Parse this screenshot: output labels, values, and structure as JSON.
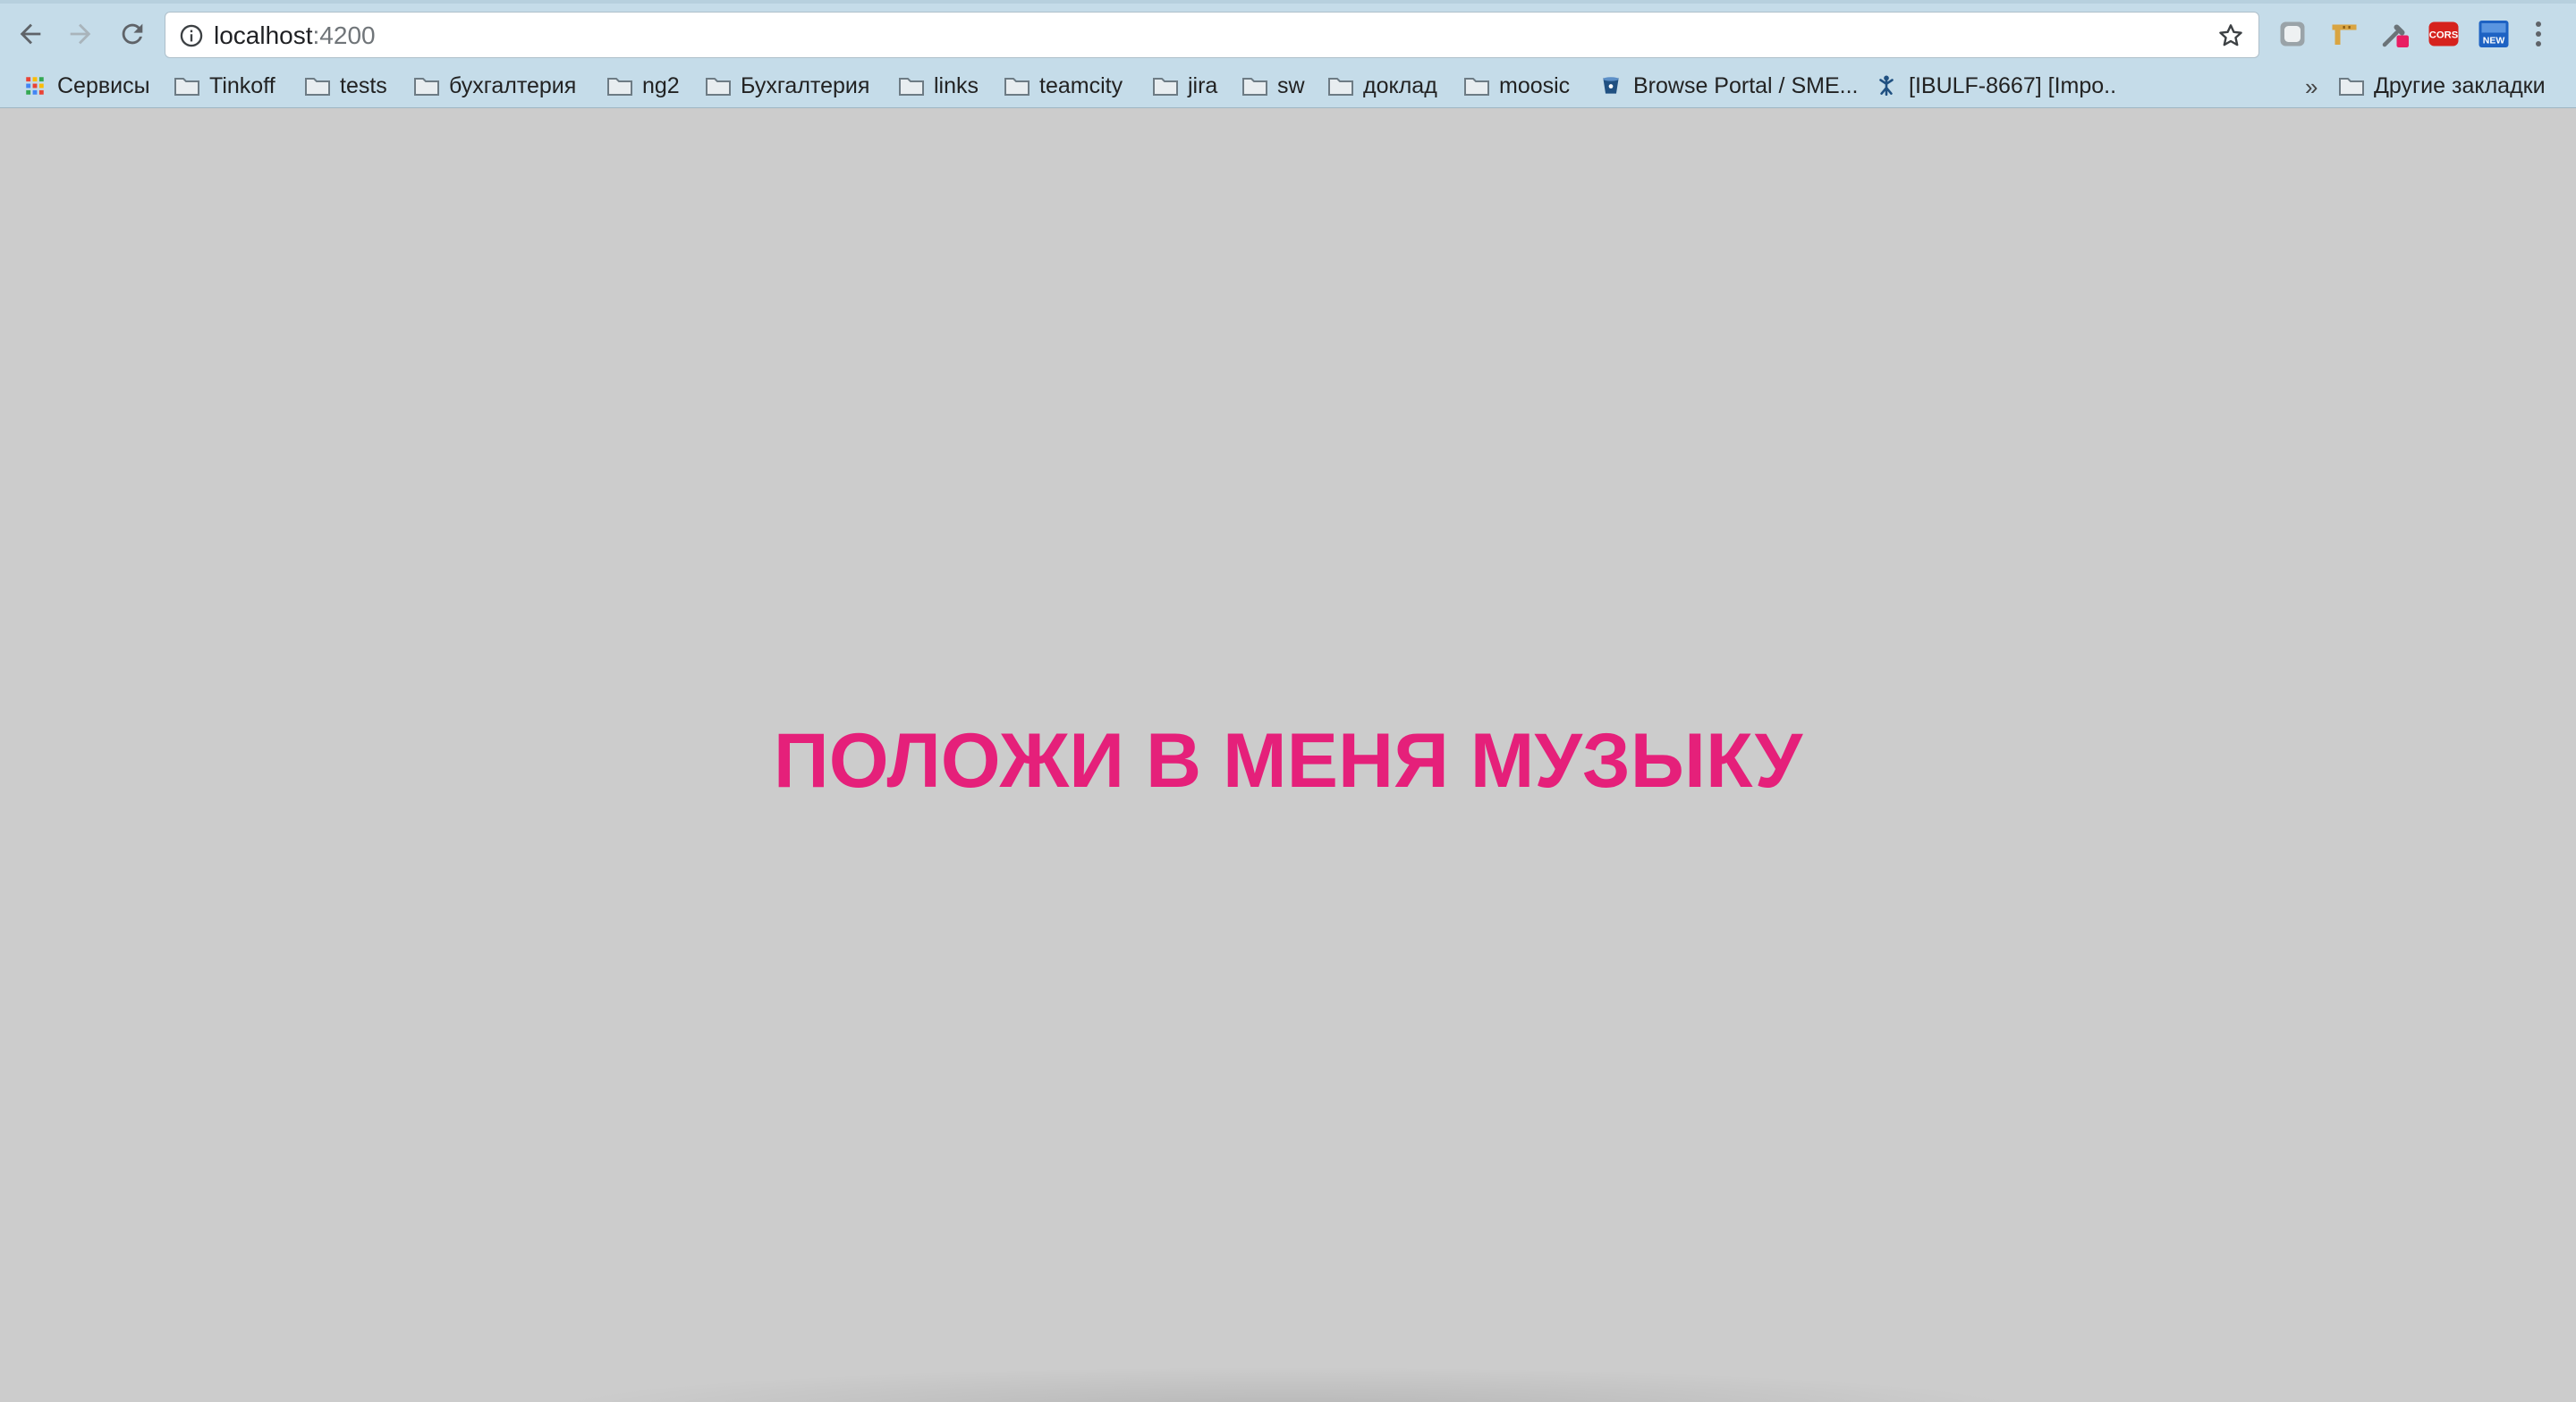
{
  "browser": {
    "url_host": "localhost",
    "url_port": ":4200",
    "bookmarks": [
      {
        "label": "Сервисы",
        "icon": "apps-grid-icon"
      },
      {
        "label": "Tinkoff",
        "icon": "folder-icon"
      },
      {
        "label": "tests",
        "icon": "folder-icon"
      },
      {
        "label": "бухгалтерия",
        "icon": "folder-icon"
      },
      {
        "label": "ng2",
        "icon": "folder-icon"
      },
      {
        "label": "Бухгалтерия",
        "icon": "folder-icon"
      },
      {
        "label": "links",
        "icon": "folder-icon"
      },
      {
        "label": "teamcity",
        "icon": "folder-icon"
      },
      {
        "label": "jira",
        "icon": "folder-icon"
      },
      {
        "label": "sw",
        "icon": "folder-icon"
      },
      {
        "label": "доклад",
        "icon": "folder-icon"
      },
      {
        "label": "moosic",
        "icon": "folder-icon"
      },
      {
        "label": "Browse Portal / SME...",
        "icon": "bitbucket-icon"
      },
      {
        "label": "[IBULF-8667] [Impo..",
        "icon": "jira-icon"
      }
    ],
    "overflow_chevron": "»",
    "other_bookmarks": "Другие закладки",
    "extensions": [
      "grey-shield-extension-icon",
      "ruler-extension-icon",
      "eyedropper-extension-icon",
      "cors-extension-icon",
      "new-badge-extension-icon"
    ],
    "extension_cors_text": "CORS",
    "extension_new_text": "NEW"
  },
  "page": {
    "headline": "ПОЛОЖИ В МЕНЯ МУЗЫКУ",
    "headline_color": "#e5207a",
    "background_color": "#cccccc"
  }
}
